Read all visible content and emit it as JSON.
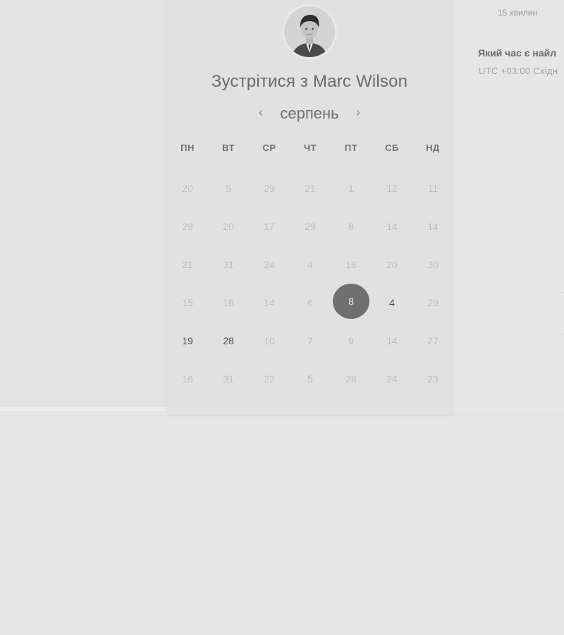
{
  "header": {
    "title": "Зустрітися з Marc Wilson",
    "avatar_alt": "Marc Wilson"
  },
  "calendar": {
    "month": "серпень",
    "prev_icon": "chevron-left-icon",
    "next_icon": "chevron-right-icon",
    "weekdays": [
      "ПН",
      "ВТ",
      "СР",
      "ЧТ",
      "ПТ",
      "СБ",
      "НД"
    ],
    "weeks": [
      [
        "20",
        "5",
        "29",
        "21",
        "1",
        "12",
        "11"
      ],
      [
        "29",
        "20",
        "17",
        "29",
        "8",
        "14",
        "14"
      ],
      [
        "21",
        "31",
        "24",
        "4",
        "18",
        "20",
        "30"
      ],
      [
        "15",
        "18",
        "14",
        "6",
        "8",
        "4",
        "29"
      ],
      [
        "19",
        "28",
        "10",
        "7",
        "9",
        "14",
        "27"
      ],
      [
        "16",
        "31",
        "22",
        "5",
        "28",
        "24",
        "23"
      ]
    ],
    "available": [
      [
        3,
        4
      ],
      [
        3,
        5
      ],
      [
        4,
        0
      ],
      [
        4,
        1
      ]
    ],
    "selected": [
      3,
      4
    ],
    "colors": {
      "selected_bg": "#707070",
      "available_text": "#4d4d4d",
      "disabled_text": "#bfbfbf"
    }
  },
  "side_panel": {
    "duration": "15 хвилин",
    "question": "Який час є найл",
    "timezone": "UTC +03:00 Східн"
  }
}
